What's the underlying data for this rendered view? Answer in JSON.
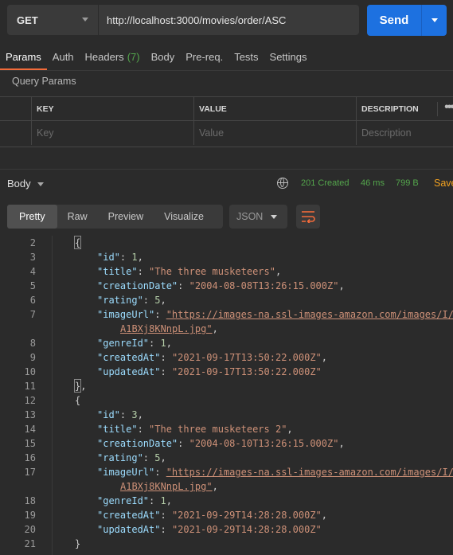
{
  "request": {
    "method": "GET",
    "url": "http://localhost:3000/movies/order/ASC",
    "send_label": "Send"
  },
  "request_tabs": [
    {
      "label": "Params",
      "active": true
    },
    {
      "label": "Auth"
    },
    {
      "label": "Headers",
      "count": "(7)"
    },
    {
      "label": "Body"
    },
    {
      "label": "Pre-req."
    },
    {
      "label": "Tests"
    },
    {
      "label": "Settings"
    }
  ],
  "query_params": {
    "title": "Query Params",
    "headers": [
      "KEY",
      "VALUE",
      "DESCRIPTION"
    ],
    "placeholders": [
      "Key",
      "Value",
      "Description"
    ]
  },
  "response": {
    "label": "Body",
    "status": "201 Created",
    "time": "46 ms",
    "size": "799 B",
    "save_label": "Save"
  },
  "viewer": {
    "tabs": [
      "Pretty",
      "Raw",
      "Preview",
      "Visualize"
    ],
    "active_tab": "Pretty",
    "format": "JSON"
  },
  "code_lines": [
    {
      "n": "2",
      "parts": [
        [
          "p",
          "{"
        ]
      ],
      "indent": 0
    },
    {
      "n": "3",
      "parts": [
        [
          "k",
          "\"id\""
        ],
        [
          "p",
          ": "
        ],
        [
          "n",
          "1"
        ],
        [
          "p",
          ","
        ]
      ],
      "indent": 1
    },
    {
      "n": "4",
      "parts": [
        [
          "k",
          "\"title\""
        ],
        [
          "p",
          ": "
        ],
        [
          "s",
          "\"The three musketeers\""
        ],
        [
          "p",
          ","
        ]
      ],
      "indent": 1
    },
    {
      "n": "5",
      "parts": [
        [
          "k",
          "\"creationDate\""
        ],
        [
          "p",
          ": "
        ],
        [
          "s",
          "\"2004-08-08T13:26:15.000Z\""
        ],
        [
          "p",
          ","
        ]
      ],
      "indent": 1
    },
    {
      "n": "6",
      "parts": [
        [
          "k",
          "\"rating\""
        ],
        [
          "p",
          ": "
        ],
        [
          "n",
          "5"
        ],
        [
          "p",
          ","
        ]
      ],
      "indent": 1
    },
    {
      "n": "7",
      "parts": [
        [
          "k",
          "\"imageUrl\""
        ],
        [
          "p",
          ": "
        ],
        [
          "u",
          "\"https://images-na.ssl-images-amazon.com/images/I/"
        ]
      ],
      "indent": 1
    },
    {
      "n": "",
      "parts": [
        [
          "u",
          "A1BXj8KNnpL.jpg\""
        ],
        [
          "p",
          ","
        ]
      ],
      "indent": 2
    },
    {
      "n": "8",
      "parts": [
        [
          "k",
          "\"genreId\""
        ],
        [
          "p",
          ": "
        ],
        [
          "n",
          "1"
        ],
        [
          "p",
          ","
        ]
      ],
      "indent": 1
    },
    {
      "n": "9",
      "parts": [
        [
          "k",
          "\"createdAt\""
        ],
        [
          "p",
          ": "
        ],
        [
          "s",
          "\"2021-09-17T13:50:22.000Z\""
        ],
        [
          "p",
          ","
        ]
      ],
      "indent": 1
    },
    {
      "n": "10",
      "parts": [
        [
          "k",
          "\"updatedAt\""
        ],
        [
          "p",
          ": "
        ],
        [
          "s",
          "\"2021-09-17T13:50:22.000Z\""
        ]
      ],
      "indent": 1
    },
    {
      "n": "11",
      "parts": [
        [
          "p",
          "},"
        ]
      ],
      "indent": 0
    },
    {
      "n": "12",
      "parts": [
        [
          "p",
          "{"
        ]
      ],
      "indent": 0
    },
    {
      "n": "13",
      "parts": [
        [
          "k",
          "\"id\""
        ],
        [
          "p",
          ": "
        ],
        [
          "n",
          "3"
        ],
        [
          "p",
          ","
        ]
      ],
      "indent": 1
    },
    {
      "n": "14",
      "parts": [
        [
          "k",
          "\"title\""
        ],
        [
          "p",
          ": "
        ],
        [
          "s",
          "\"The three musketeers 2\""
        ],
        [
          "p",
          ","
        ]
      ],
      "indent": 1
    },
    {
      "n": "15",
      "parts": [
        [
          "k",
          "\"creationDate\""
        ],
        [
          "p",
          ": "
        ],
        [
          "s",
          "\"2004-08-10T13:26:15.000Z\""
        ],
        [
          "p",
          ","
        ]
      ],
      "indent": 1
    },
    {
      "n": "16",
      "parts": [
        [
          "k",
          "\"rating\""
        ],
        [
          "p",
          ": "
        ],
        [
          "n",
          "5"
        ],
        [
          "p",
          ","
        ]
      ],
      "indent": 1
    },
    {
      "n": "17",
      "parts": [
        [
          "k",
          "\"imageUrl\""
        ],
        [
          "p",
          ": "
        ],
        [
          "u",
          "\"https://images-na.ssl-images-amazon.com/images/I/"
        ]
      ],
      "indent": 1
    },
    {
      "n": "",
      "parts": [
        [
          "u",
          "A1BXj8KNnpL.jpg\""
        ],
        [
          "p",
          ","
        ]
      ],
      "indent": 2
    },
    {
      "n": "18",
      "parts": [
        [
          "k",
          "\"genreId\""
        ],
        [
          "p",
          ": "
        ],
        [
          "n",
          "1"
        ],
        [
          "p",
          ","
        ]
      ],
      "indent": 1
    },
    {
      "n": "19",
      "parts": [
        [
          "k",
          "\"createdAt\""
        ],
        [
          "p",
          ": "
        ],
        [
          "s",
          "\"2021-09-29T14:28:28.000Z\""
        ],
        [
          "p",
          ","
        ]
      ],
      "indent": 1
    },
    {
      "n": "20",
      "parts": [
        [
          "k",
          "\"updatedAt\""
        ],
        [
          "p",
          ": "
        ],
        [
          "s",
          "\"2021-09-29T14:28:28.000Z\""
        ]
      ],
      "indent": 1
    },
    {
      "n": "21",
      "parts": [
        [
          "p",
          "}"
        ]
      ],
      "indent": 0
    }
  ],
  "colors": {
    "accent_send": "#1d71e0",
    "active_tab_underline": "#f26b3a",
    "status_green": "#54a64c",
    "save_orange": "#f0a020"
  }
}
